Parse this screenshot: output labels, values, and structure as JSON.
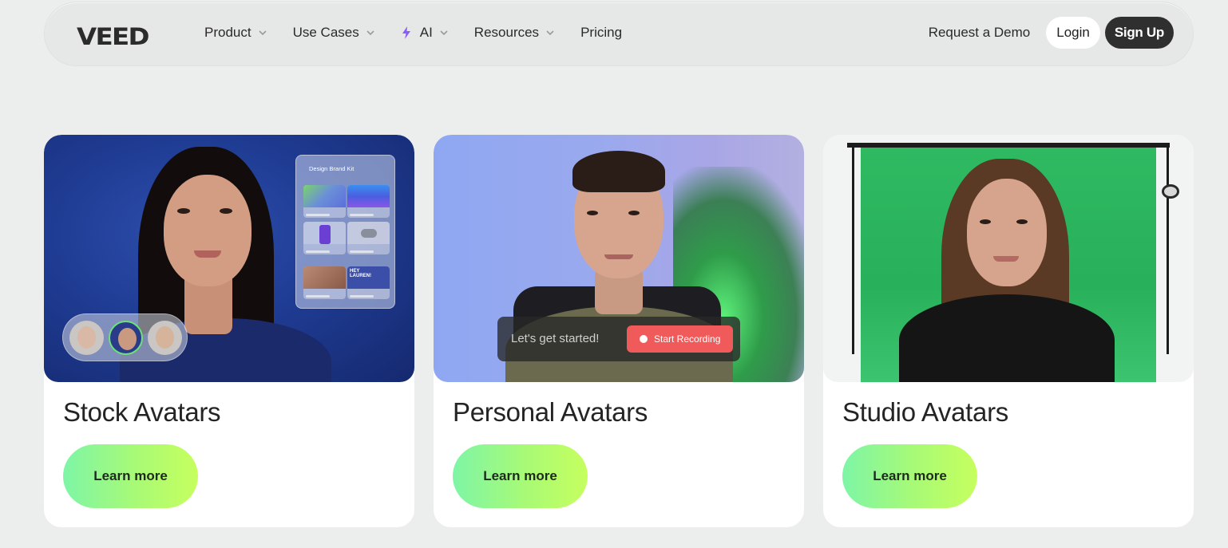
{
  "nav": {
    "logo": "VEED",
    "menu": [
      {
        "label": "Product",
        "has_dropdown": true
      },
      {
        "label": "Use Cases",
        "has_dropdown": true
      },
      {
        "label": "AI",
        "has_dropdown": true,
        "icon": "sparkle-icon"
      },
      {
        "label": "Resources",
        "has_dropdown": true
      },
      {
        "label": "Pricing",
        "has_dropdown": false
      }
    ],
    "request_demo": "Request a Demo",
    "login": "Login",
    "signup": "Sign Up"
  },
  "cards": [
    {
      "title": "Stock Avatars",
      "button": "Learn more",
      "overlay": {
        "panel_title": "Design Brand Kit",
        "tile_caption": "HEY LAUREN!"
      }
    },
    {
      "title": "Personal Avatars",
      "button": "Learn more",
      "overlay": {
        "prompt": "Let's get started!",
        "record_button": "Start Recording"
      }
    },
    {
      "title": "Studio Avatars",
      "button": "Learn more"
    }
  ],
  "colors": {
    "background": "#eceeed",
    "signup_bg": "#2f2f2f",
    "cta_gradient_start": "#7ef5a6",
    "cta_gradient_end": "#c6ff5e",
    "record_red": "#f05a5a",
    "ai_accent": "#8b5cf6"
  }
}
